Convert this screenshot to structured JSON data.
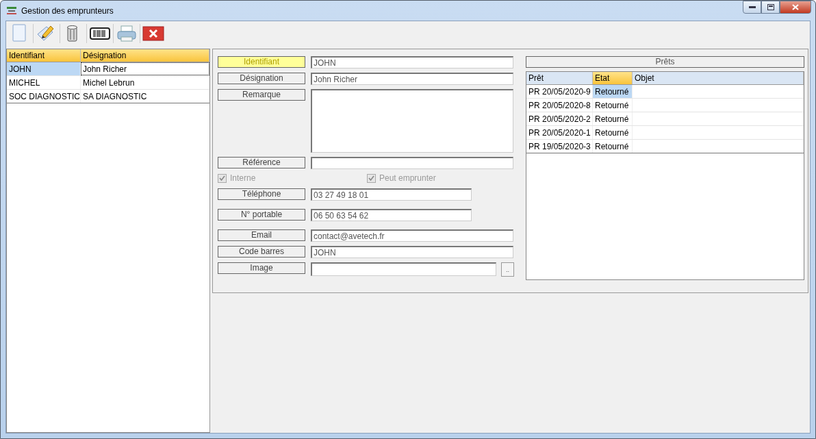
{
  "window": {
    "title": "Gestion des emprunteurs"
  },
  "toolbar": [
    {
      "kind": "new"
    },
    {
      "kind": "edit"
    },
    {
      "kind": "delete"
    },
    {
      "kind": "barcode"
    },
    {
      "kind": "print"
    },
    {
      "kind": "close"
    }
  ],
  "borrowers": {
    "columns": [
      {
        "label": "Identifiant",
        "selected": true
      },
      {
        "label": "Désignation",
        "selected": true
      }
    ],
    "rows": [
      {
        "cells": [
          "JOHN",
          "John Richer"
        ],
        "selected": true
      },
      {
        "cells": [
          "MICHEL",
          "Michel Lebrun"
        ],
        "selected": false
      },
      {
        "cells": [
          "SOC DIAGNOSTIC",
          "SA DIAGNOSTIC"
        ],
        "selected": false
      }
    ]
  },
  "form": {
    "fields": [
      {
        "label": "Identifiant",
        "value": "JOHN",
        "kind": "text",
        "focused": true
      },
      {
        "label": "Désignation",
        "value": "John Richer",
        "kind": "text",
        "focused": false
      },
      {
        "label": "Remarque",
        "kind": "memo",
        "focused": false
      },
      {
        "label": "Référence",
        "kind": "text",
        "focused": false
      },
      {
        "kind": "checks",
        "checks": [
          {
            "label": "Interne",
            "checked": true,
            "disabled": true
          },
          {
            "label": "Peut emprunter",
            "checked": true,
            "disabled": true
          }
        ]
      },
      {
        "label": "Téléphone",
        "value": "03 27 49 18 01",
        "kind": "short",
        "focused": false
      },
      {
        "label": "N° portable",
        "value": "06 50 63 54 62",
        "kind": "short",
        "focused": false
      },
      {
        "label": "Email",
        "value": "contact@avetech.fr",
        "kind": "text",
        "focused": false
      },
      {
        "label": "Code barres",
        "value": "JOHN",
        "kind": "text",
        "focused": false
      },
      {
        "label": "Image",
        "kind": "file",
        "button": "..",
        "focused": false
      }
    ]
  },
  "loans": {
    "title": "Prêts",
    "columns": [
      {
        "label": "Prêt",
        "selected": false
      },
      {
        "label": "Etat",
        "selected": true
      },
      {
        "label": "Objet",
        "selected": false
      }
    ],
    "rows": [
      {
        "cells": [
          "PR 20/05/2020-9",
          "Retourné"
        ],
        "selected": true
      },
      {
        "cells": [
          "PR 20/05/2020-8",
          "Retourné"
        ],
        "selected": false
      },
      {
        "cells": [
          "PR 20/05/2020-2",
          "Retourné"
        ],
        "selected": false
      },
      {
        "cells": [
          "PR 20/05/2020-1",
          "Retourné"
        ],
        "selected": false
      },
      {
        "cells": [
          "PR 19/05/2020-3",
          "Retourné"
        ],
        "selected": false
      }
    ]
  }
}
